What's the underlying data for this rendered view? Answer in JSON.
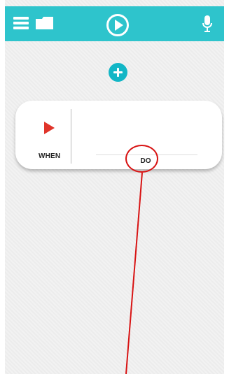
{
  "header": {
    "menu_icon": "hamburger-menu-icon",
    "folder_icon": "folder-icon",
    "play_icon": "play-circle-icon",
    "mic_icon": "microphone-icon"
  },
  "actions": {
    "add_icon": "add-icon"
  },
  "rule_card": {
    "when_label": "WHEN",
    "when_icon": "play-triangle-icon",
    "do_label": "DO"
  },
  "annotation": {
    "target": "DO"
  },
  "colors": {
    "header_bg": "#2ec4cc",
    "add_button": "#12b6c6",
    "play_red": "#e0342a",
    "annotation_red": "#d81414"
  }
}
